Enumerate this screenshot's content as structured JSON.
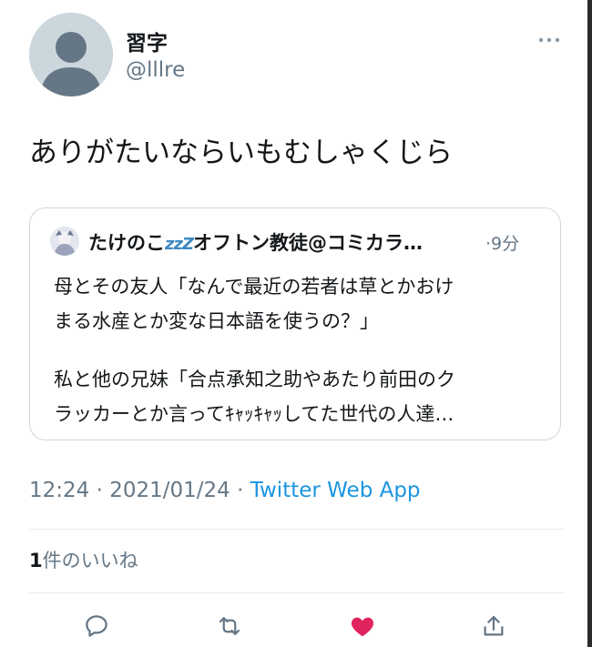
{
  "author": {
    "name": "習字",
    "handle": "@lllre"
  },
  "tweet": {
    "text": "ありがたいならいもむしゃくじら"
  },
  "quote": {
    "name": "たけのこ",
    "zzz": "zzZ",
    "name_rest": "オフトン教徒@コミカラ…",
    "time": "·9分",
    "lines": [
      "母とその友人「なんで最近の若者は草とかおけ",
      "まる水産とか変な日本語を使うの？」",
      "私と他の兄妹「合点承知之助やあたり前田のク",
      "ラッカーとか言ってｷｬｯｷｬｯしてた世代の人達…"
    ]
  },
  "meta": {
    "time": "12:24",
    "sep1": " · ",
    "date": "2021/01/24",
    "sep2": " · ",
    "source": "Twitter Web App"
  },
  "likes": {
    "count": "1",
    "label": "件のいいね"
  },
  "actions": {
    "reply_icon": "reply-icon",
    "retweet_icon": "retweet-icon",
    "like_icon": "heart-icon",
    "share_icon": "share-icon",
    "like_color": "#e0245e"
  }
}
